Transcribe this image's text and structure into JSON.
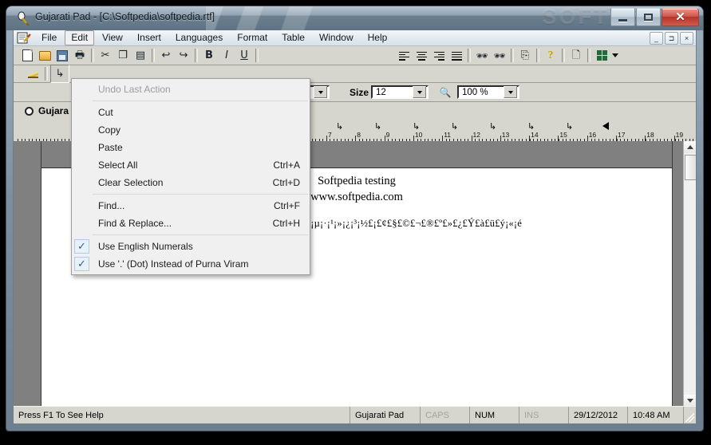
{
  "window": {
    "title": "Gujarati Pad - [C:\\Softpedia\\softpedia.rtf]",
    "watermark": "SOFTPEDIA",
    "app_icon": "gujarati-pad-icon",
    "buttons": {
      "minimize": "–",
      "maximize": "□",
      "close": "X"
    }
  },
  "mdi_buttons": {
    "minimize": "_",
    "restore": "⊐",
    "close": "×"
  },
  "menubar": {
    "items": [
      {
        "label": "File",
        "open": false
      },
      {
        "label": "Edit",
        "open": true
      },
      {
        "label": "View",
        "open": false
      },
      {
        "label": "Insert",
        "open": false
      },
      {
        "label": "Languages",
        "open": false
      },
      {
        "label": "Format",
        "open": false
      },
      {
        "label": "Table",
        "open": false
      },
      {
        "label": "Window",
        "open": false
      },
      {
        "label": "Help",
        "open": false
      }
    ]
  },
  "edit_menu": {
    "groups": [
      [
        {
          "label": "Undo Last Action",
          "accel": "",
          "disabled": true,
          "checked": null
        }
      ],
      [
        {
          "label": "Cut",
          "accel": "",
          "disabled": false,
          "checked": null
        },
        {
          "label": "Copy",
          "accel": "",
          "disabled": false,
          "checked": null
        },
        {
          "label": "Paste",
          "accel": "",
          "disabled": false,
          "checked": null
        },
        {
          "label": "Select All",
          "accel": "Ctrl+A",
          "disabled": false,
          "checked": null
        },
        {
          "label": "Clear Selection",
          "accel": "Ctrl+D",
          "disabled": false,
          "checked": null
        }
      ],
      [
        {
          "label": "Find...",
          "accel": "Ctrl+F",
          "disabled": false,
          "checked": null
        },
        {
          "label": "Find & Replace...",
          "accel": "Ctrl+H",
          "disabled": false,
          "checked": null
        }
      ],
      [
        {
          "label": "Use English Numerals",
          "accel": "",
          "disabled": false,
          "checked": true
        },
        {
          "label": "Use '.' (Dot) Instead of Purna Viram",
          "accel": "",
          "disabled": false,
          "checked": true
        }
      ]
    ],
    "check_glyph": "✓"
  },
  "toolbar1": {
    "icons": [
      "new-document-icon",
      "open-folder-icon",
      "save-icon",
      "print-icon",
      "print-preview-icon",
      "cut-icon",
      "copy-icon",
      "paste-icon",
      "undo-icon",
      "redo-icon",
      "bold-icon",
      "italic-icon",
      "underline-icon",
      "align-left-icon",
      "align-center-icon",
      "align-right-icon",
      "align-justify-icon",
      "find-icon",
      "find-replace-icon",
      "insert-symbol-icon",
      "help-icon",
      "eraser-icon",
      "table-icon",
      "table-dropdown-icon"
    ]
  },
  "toolbar2": {
    "icons": [
      "highlight-pencil-icon",
      "paragraph-return-icon"
    ]
  },
  "font_controls": {
    "size_label": "Size",
    "size_value": "12",
    "zoom_icon": "zoom-magnifier-icon",
    "zoom_value": "100 %"
  },
  "language_row": {
    "radio_label": "Gujara",
    "radio_name": "gujarati-radio",
    "selected": false
  },
  "ruler": {
    "numbers": [
      "7",
      "8",
      "9",
      "10",
      "11",
      "12",
      "13",
      "14",
      "15",
      "16",
      "17",
      "18",
      "19"
    ],
    "tab_glyph": "↳",
    "tab_count": 7,
    "indent_marker": "right-indent-marker"
  },
  "document": {
    "line1": "Softpedia testing",
    "line2": "www.softpedia.com",
    "line3": "¡§¡¤¡¦¡¥Ð¡¬¡¯¡±¡-¡Ã¡¢¡£¡¨¡©¡µ¡·¡¹¡»¡¿¡³¡½£¡£¢£§£©£¬£®£º£»£¿£Ý£à£ü£ý¡«¡é"
  },
  "scrollbar": {
    "up": "scroll-up-arrow",
    "down": "scroll-down-arrow",
    "thumb": "scroll-thumb"
  },
  "statusbar": {
    "hint": "Press F1 To See Help",
    "app": "Gujarati Pad",
    "caps": "CAPS",
    "caps_active": false,
    "num": "NUM",
    "num_active": true,
    "ins": "INS",
    "ins_active": false,
    "date": "29/12/2012",
    "time": "10:48 AM"
  }
}
